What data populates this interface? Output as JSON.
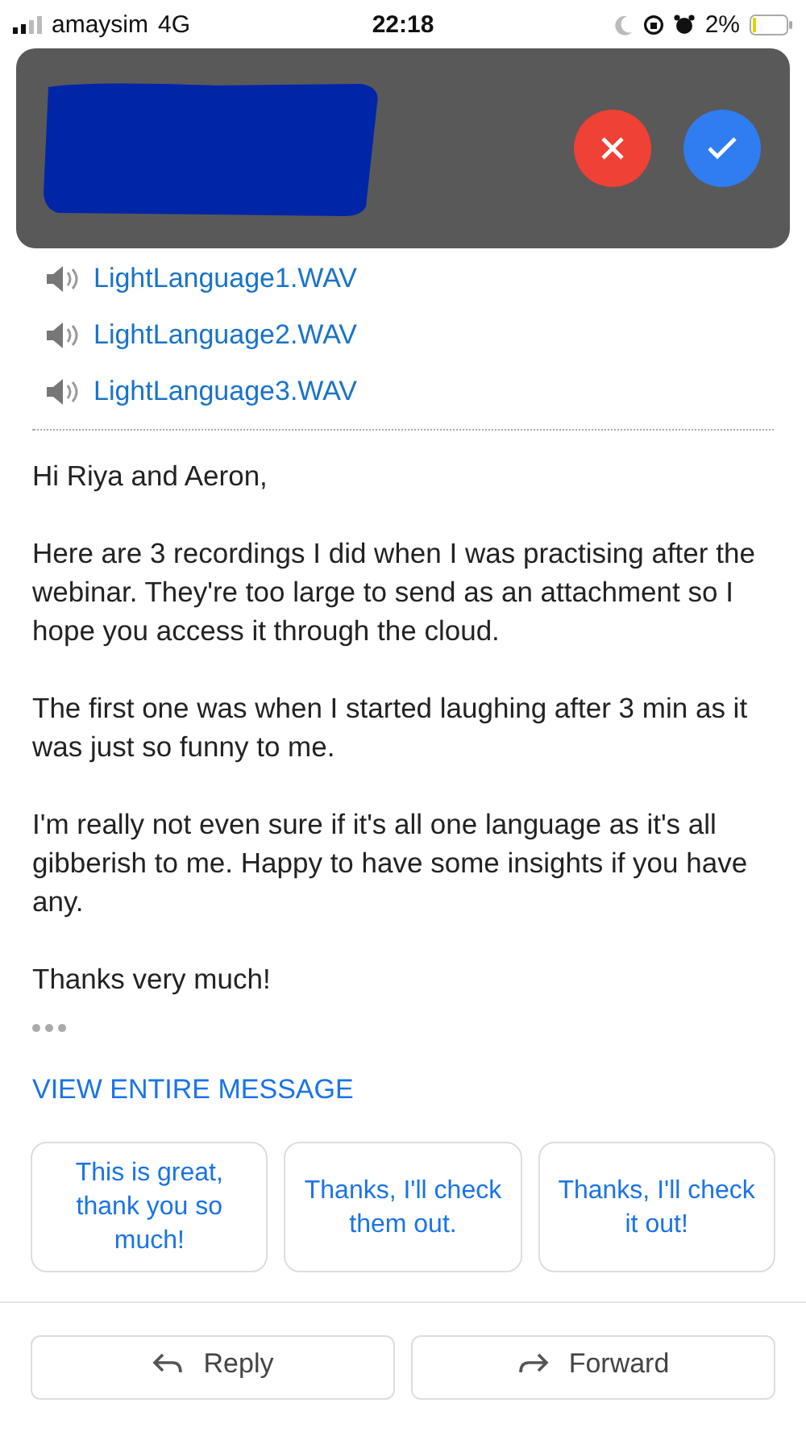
{
  "status_bar": {
    "carrier": "amaysim",
    "network": "4G",
    "time": "22:18",
    "battery": "2%"
  },
  "attachments": [
    {
      "name": "LightLanguage1.WAV"
    },
    {
      "name": "LightLanguage2.WAV"
    },
    {
      "name": "LightLanguage3.WAV"
    }
  ],
  "body": [
    "Hi Riya and Aeron,",
    "Here are 3 recordings I did when I was practising after the webinar. They're too large to send as an attachment so I hope you access it through the cloud.",
    "The first one was when I started laughing after 3 min as it was just so funny to me.",
    "I'm really not even sure if it's all one language as it's all gibberish to me. Happy to have some insights if you have any.",
    "Thanks very much!"
  ],
  "view_entire_message": "VIEW ENTIRE MESSAGE",
  "smart_replies": [
    "This is great, thank you so much!",
    "Thanks, I'll check them out.",
    "Thanks, I'll check it out!"
  ],
  "actions": [
    {
      "kind": "reply",
      "label": "Reply"
    },
    {
      "kind": "forward",
      "label": "Forward"
    }
  ]
}
